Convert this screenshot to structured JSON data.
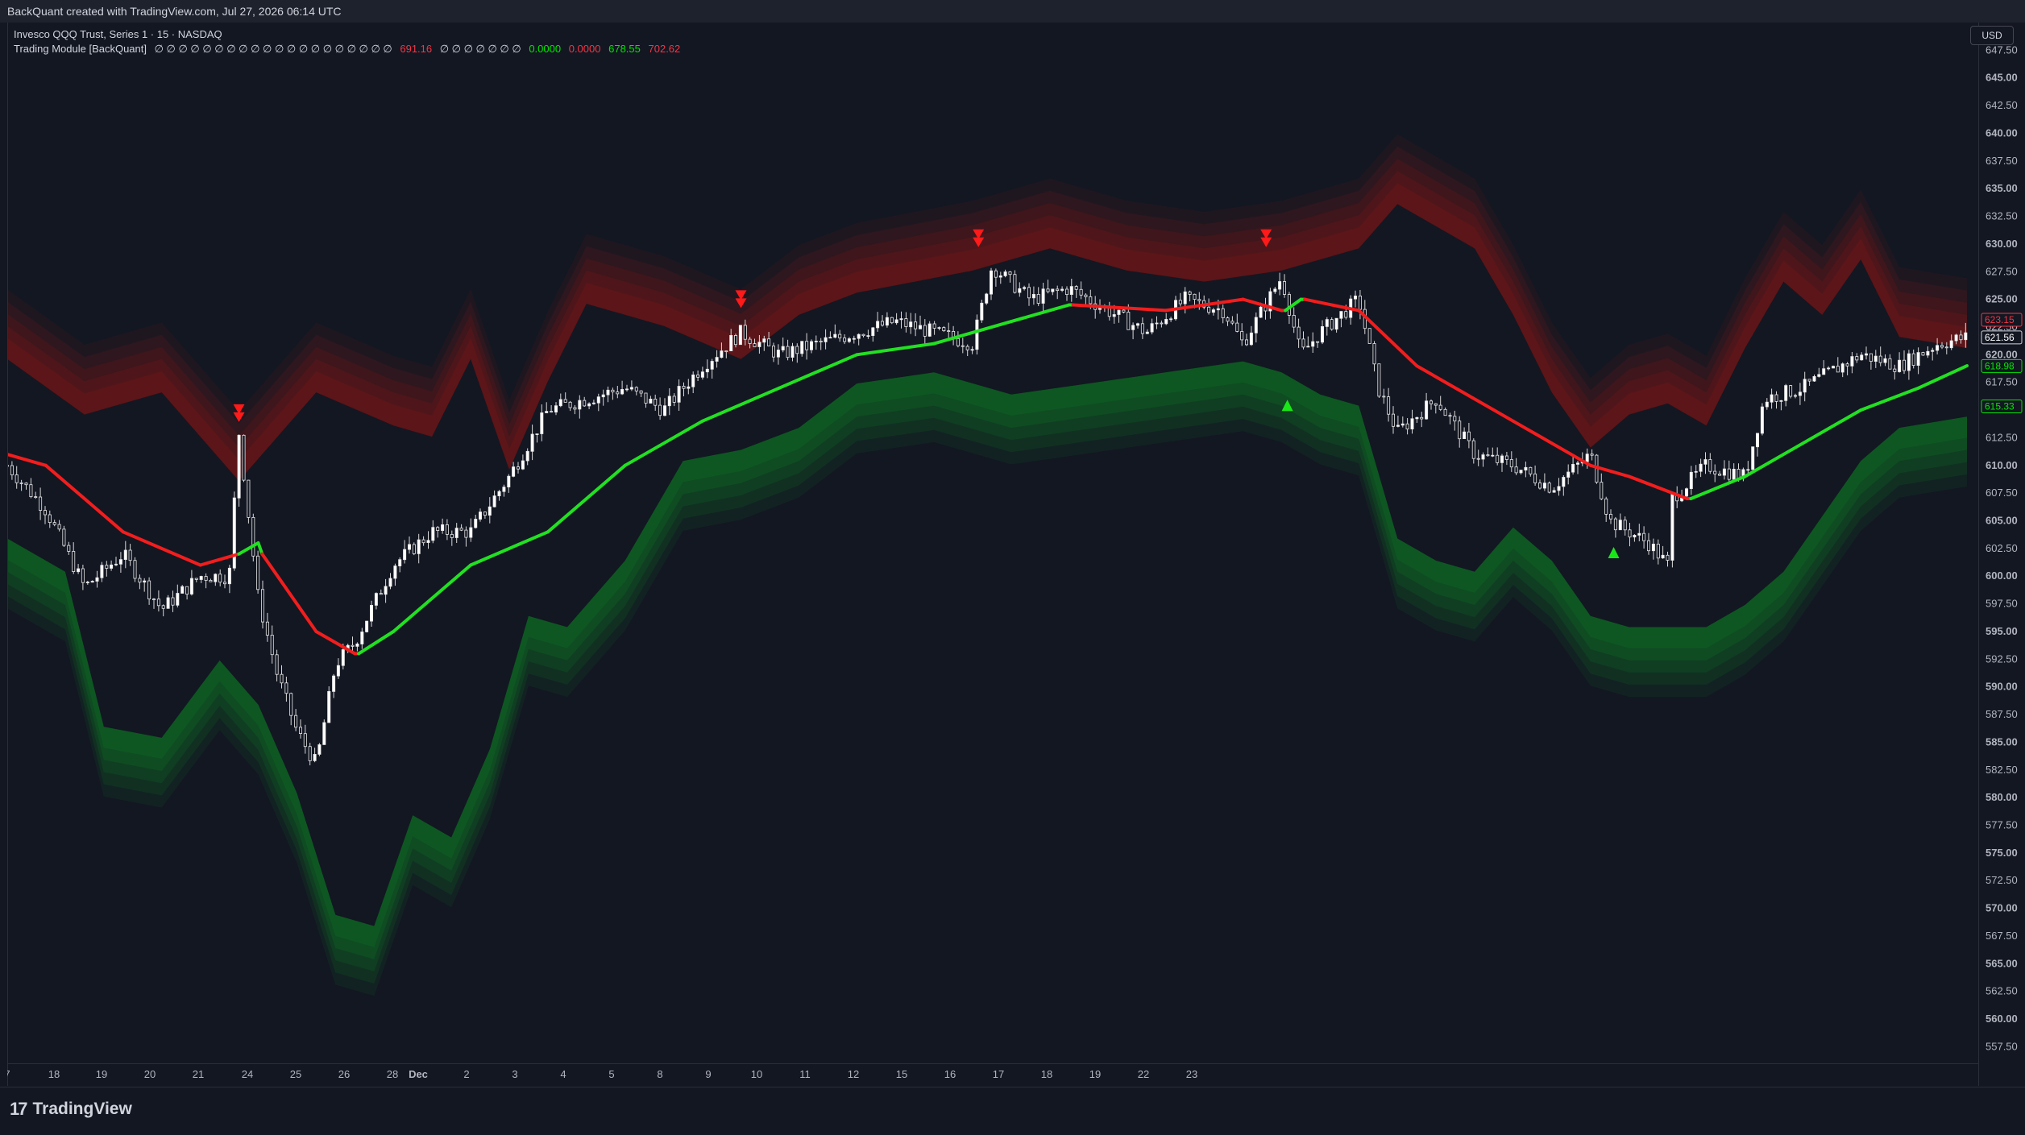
{
  "header": {
    "attribution": "BackQuant created with TradingView.com, Jul 27, 2026 06:14 UTC"
  },
  "legend": {
    "symbol_line": "Invesco QQQ Trust, Series 1 · 15 · NASDAQ",
    "indicator_name": "Trading Module [BackQuant]",
    "na_glyphs": "∅ ∅ ∅ ∅ ∅ ∅ ∅ ∅ ∅ ∅ ∅ ∅ ∅ ∅ ∅ ∅ ∅ ∅ ∅ ∅",
    "values": [
      {
        "text": "691.16",
        "color": "#f23645"
      },
      {
        "text": "∅ ∅ ∅ ∅ ∅ ∅ ∅",
        "color": "#d1d4dc"
      },
      {
        "text": "0.0000",
        "color": "#00e600"
      },
      {
        "text": "0.0000",
        "color": "#f23645"
      },
      {
        "text": "678.55",
        "color": "#00e600"
      },
      {
        "text": "702.62",
        "color": "#f23645"
      }
    ]
  },
  "currency_button": "USD",
  "footer": {
    "brand_logo": "17",
    "brand_name": "TradingView"
  },
  "colors": {
    "background": "#131722",
    "bull": "#22e022",
    "bear": "#f21d1d",
    "candle": "#ffffff",
    "band_upper": "#8b1a1a",
    "band_lower": "#0f6b24"
  },
  "chart_data": {
    "type": "candlestick",
    "title": "Invesco QQQ Trust, Series 1 · 15 · NASDAQ",
    "ylim": [
      556,
      650
    ],
    "y_ticks": [
      "647.50",
      "645.00",
      "642.50",
      "640.00",
      "637.50",
      "635.00",
      "632.50",
      "630.00",
      "627.50",
      "625.00",
      "622.50",
      "620.00",
      "617.50",
      "615.00",
      "612.50",
      "610.00",
      "607.50",
      "605.00",
      "602.50",
      "600.00",
      "597.50",
      "595.00",
      "592.50",
      "590.00",
      "587.50",
      "585.00",
      "582.50",
      "580.00",
      "577.50",
      "575.00",
      "572.50",
      "570.00",
      "567.50",
      "565.00",
      "562.50",
      "560.00",
      "557.50"
    ],
    "x_ticks": [
      "7",
      "18",
      "19",
      "20",
      "21",
      "24",
      "25",
      "26",
      "28",
      "Dec",
      "2",
      "3",
      "4",
      "5",
      "8",
      "9",
      "10",
      "11",
      "12",
      "15",
      "16",
      "17",
      "18",
      "19",
      "22",
      "23"
    ],
    "price_path": [
      {
        "t": 0,
        "p": 610
      },
      {
        "t": 2,
        "p": 606
      },
      {
        "t": 4,
        "p": 599
      },
      {
        "t": 6,
        "p": 602
      },
      {
        "t": 8,
        "p": 597
      },
      {
        "t": 10,
        "p": 600
      },
      {
        "t": 11.5,
        "p": 600
      },
      {
        "t": 12,
        "p": 613
      },
      {
        "t": 13,
        "p": 598
      },
      {
        "t": 14,
        "p": 591
      },
      {
        "t": 15,
        "p": 586
      },
      {
        "t": 16,
        "p": 583
      },
      {
        "t": 17,
        "p": 592
      },
      {
        "t": 18,
        "p": 594
      },
      {
        "t": 20,
        "p": 601
      },
      {
        "t": 22,
        "p": 604
      },
      {
        "t": 24,
        "p": 604
      },
      {
        "t": 26,
        "p": 609
      },
      {
        "t": 28,
        "p": 615
      },
      {
        "t": 30,
        "p": 616
      },
      {
        "t": 32,
        "p": 617
      },
      {
        "t": 34,
        "p": 615
      },
      {
        "t": 36,
        "p": 619
      },
      {
        "t": 38,
        "p": 622
      },
      {
        "t": 40,
        "p": 620
      },
      {
        "t": 42,
        "p": 621
      },
      {
        "t": 44,
        "p": 622
      },
      {
        "t": 46,
        "p": 623
      },
      {
        "t": 48,
        "p": 622
      },
      {
        "t": 50,
        "p": 621
      },
      {
        "t": 51,
        "p": 628
      },
      {
        "t": 53,
        "p": 625
      },
      {
        "t": 55,
        "p": 626
      },
      {
        "t": 57,
        "p": 624
      },
      {
        "t": 59,
        "p": 622
      },
      {
        "t": 61,
        "p": 625
      },
      {
        "t": 63,
        "p": 624
      },
      {
        "t": 64,
        "p": 621
      },
      {
        "t": 65,
        "p": 624
      },
      {
        "t": 66,
        "p": 627
      },
      {
        "t": 67,
        "p": 620
      },
      {
        "t": 68,
        "p": 622
      },
      {
        "t": 70,
        "p": 625
      },
      {
        "t": 71,
        "p": 617
      },
      {
        "t": 72,
        "p": 613
      },
      {
        "t": 74,
        "p": 616
      },
      {
        "t": 76,
        "p": 611
      },
      {
        "t": 78,
        "p": 610
      },
      {
        "t": 80,
        "p": 608
      },
      {
        "t": 82,
        "p": 611
      },
      {
        "t": 83,
        "p": 605
      },
      {
        "t": 85,
        "p": 603
      },
      {
        "t": 86,
        "p": 601
      },
      {
        "t": 86.2,
        "p": 607
      },
      {
        "t": 88,
        "p": 610
      },
      {
        "t": 90,
        "p": 609
      },
      {
        "t": 91,
        "p": 616
      },
      {
        "t": 93,
        "p": 617
      },
      {
        "t": 95,
        "p": 619
      },
      {
        "t": 96,
        "p": 620
      },
      {
        "t": 98,
        "p": 619
      },
      {
        "t": 100,
        "p": 621
      },
      {
        "t": 101.5,
        "p": 621.56
      }
    ],
    "trend_line": [
      {
        "t": 0,
        "p": 611,
        "s": "bear"
      },
      {
        "t": 2,
        "p": 610,
        "s": "bear"
      },
      {
        "t": 6,
        "p": 604,
        "s": "bear"
      },
      {
        "t": 10,
        "p": 601,
        "s": "bear"
      },
      {
        "t": 12,
        "p": 602,
        "s": "bull"
      },
      {
        "t": 13,
        "p": 603,
        "s": "bull"
      },
      {
        "t": 13.2,
        "p": 602,
        "s": "bear"
      },
      {
        "t": 16,
        "p": 595,
        "s": "bear"
      },
      {
        "t": 18,
        "p": 593,
        "s": "bear"
      },
      {
        "t": 18.2,
        "p": 593,
        "s": "bull"
      },
      {
        "t": 20,
        "p": 595,
        "s": "bull"
      },
      {
        "t": 24,
        "p": 601,
        "s": "bull"
      },
      {
        "t": 28,
        "p": 604,
        "s": "bull"
      },
      {
        "t": 32,
        "p": 610,
        "s": "bull"
      },
      {
        "t": 36,
        "p": 614,
        "s": "bull"
      },
      {
        "t": 40,
        "p": 617,
        "s": "bull"
      },
      {
        "t": 44,
        "p": 620,
        "s": "bull"
      },
      {
        "t": 48,
        "p": 621,
        "s": "bull"
      },
      {
        "t": 52,
        "p": 623,
        "s": "bull"
      },
      {
        "t": 55,
        "p": 624.5,
        "s": "bull"
      },
      {
        "t": 55.2,
        "p": 624.5,
        "s": "bear"
      },
      {
        "t": 60,
        "p": 624,
        "s": "bear"
      },
      {
        "t": 64,
        "p": 625,
        "s": "bear"
      },
      {
        "t": 66,
        "p": 624,
        "s": "bear"
      },
      {
        "t": 66.2,
        "p": 624,
        "s": "bull"
      },
      {
        "t": 67,
        "p": 625,
        "s": "bull"
      },
      {
        "t": 67.2,
        "p": 625,
        "s": "bear"
      },
      {
        "t": 70,
        "p": 624,
        "s": "bear"
      },
      {
        "t": 73,
        "p": 619,
        "s": "bear"
      },
      {
        "t": 78,
        "p": 614,
        "s": "bear"
      },
      {
        "t": 82,
        "p": 610,
        "s": "bear"
      },
      {
        "t": 84,
        "p": 609,
        "s": "bear"
      },
      {
        "t": 87,
        "p": 607,
        "s": "bear"
      },
      {
        "t": 87.2,
        "p": 607,
        "s": "bull"
      },
      {
        "t": 90,
        "p": 609,
        "s": "bull"
      },
      {
        "t": 93,
        "p": 612,
        "s": "bull"
      },
      {
        "t": 96,
        "p": 615,
        "s": "bull"
      },
      {
        "t": 99,
        "p": 617,
        "s": "bull"
      },
      {
        "t": 101.5,
        "p": 619,
        "s": "bull"
      }
    ],
    "upper_band": [
      {
        "t": 0,
        "p": 620
      },
      {
        "t": 4,
        "p": 615
      },
      {
        "t": 8,
        "p": 617
      },
      {
        "t": 12,
        "p": 609
      },
      {
        "t": 16,
        "p": 617
      },
      {
        "t": 20,
        "p": 614
      },
      {
        "t": 22,
        "p": 613
      },
      {
        "t": 24,
        "p": 620
      },
      {
        "t": 26,
        "p": 610
      },
      {
        "t": 28,
        "p": 618
      },
      {
        "t": 30,
        "p": 625
      },
      {
        "t": 34,
        "p": 623
      },
      {
        "t": 38,
        "p": 620
      },
      {
        "t": 41,
        "p": 624
      },
      {
        "t": 44,
        "p": 626
      },
      {
        "t": 50,
        "p": 628
      },
      {
        "t": 54,
        "p": 630
      },
      {
        "t": 58,
        "p": 628
      },
      {
        "t": 62,
        "p": 627
      },
      {
        "t": 66,
        "p": 628
      },
      {
        "t": 70,
        "p": 630
      },
      {
        "t": 72,
        "p": 634
      },
      {
        "t": 76,
        "p": 630
      },
      {
        "t": 78,
        "p": 624
      },
      {
        "t": 80,
        "p": 617
      },
      {
        "t": 82,
        "p": 612
      },
      {
        "t": 84,
        "p": 615
      },
      {
        "t": 86,
        "p": 616
      },
      {
        "t": 88,
        "p": 614
      },
      {
        "t": 90,
        "p": 621
      },
      {
        "t": 92,
        "p": 627
      },
      {
        "t": 94,
        "p": 624
      },
      {
        "t": 96,
        "p": 629
      },
      {
        "t": 98,
        "p": 622
      },
      {
        "t": 101.5,
        "p": 621
      }
    ],
    "lower_band": [
      {
        "t": 0,
        "p": 603
      },
      {
        "t": 3,
        "p": 600
      },
      {
        "t": 5,
        "p": 586
      },
      {
        "t": 8,
        "p": 585
      },
      {
        "t": 11,
        "p": 592
      },
      {
        "t": 13,
        "p": 588
      },
      {
        "t": 15,
        "p": 580
      },
      {
        "t": 17,
        "p": 569
      },
      {
        "t": 19,
        "p": 568
      },
      {
        "t": 21,
        "p": 578
      },
      {
        "t": 23,
        "p": 576
      },
      {
        "t": 25,
        "p": 584
      },
      {
        "t": 27,
        "p": 596
      },
      {
        "t": 29,
        "p": 595
      },
      {
        "t": 32,
        "p": 601
      },
      {
        "t": 35,
        "p": 610
      },
      {
        "t": 38,
        "p": 611
      },
      {
        "t": 41,
        "p": 613
      },
      {
        "t": 44,
        "p": 617
      },
      {
        "t": 48,
        "p": 618
      },
      {
        "t": 52,
        "p": 616
      },
      {
        "t": 56,
        "p": 617
      },
      {
        "t": 60,
        "p": 618
      },
      {
        "t": 64,
        "p": 619
      },
      {
        "t": 66,
        "p": 618
      },
      {
        "t": 68,
        "p": 616
      },
      {
        "t": 70,
        "p": 615
      },
      {
        "t": 72,
        "p": 603
      },
      {
        "t": 74,
        "p": 601
      },
      {
        "t": 76,
        "p": 600
      },
      {
        "t": 78,
        "p": 604
      },
      {
        "t": 80,
        "p": 601
      },
      {
        "t": 82,
        "p": 596
      },
      {
        "t": 84,
        "p": 595
      },
      {
        "t": 86,
        "p": 595
      },
      {
        "t": 88,
        "p": 595
      },
      {
        "t": 90,
        "p": 597
      },
      {
        "t": 92,
        "p": 600
      },
      {
        "t": 94,
        "p": 605
      },
      {
        "t": 96,
        "p": 610
      },
      {
        "t": 98,
        "p": 613
      },
      {
        "t": 101.5,
        "p": 614
      }
    ],
    "signals": [
      {
        "t": 12,
        "p": 614.5,
        "dir": "sell"
      },
      {
        "t": 38,
        "p": 624.8,
        "dir": "sell"
      },
      {
        "t": 50.3,
        "p": 630.3,
        "dir": "sell"
      },
      {
        "t": 65.2,
        "p": 630.3,
        "dir": "sell"
      },
      {
        "t": 66.3,
        "p": 615.5,
        "dir": "buy"
      },
      {
        "t": 83.2,
        "p": 602.2,
        "dir": "buy"
      }
    ],
    "price_tags": [
      {
        "text": "623.15",
        "p": 623.15,
        "border": "#f23645",
        "color": "#f23645"
      },
      {
        "text": "621.56",
        "p": 621.56,
        "border": "#d1d4dc",
        "color": "#ffffff"
      },
      {
        "text": "618.98",
        "p": 618.98,
        "border": "#00e600",
        "color": "#00e600"
      },
      {
        "text": "615.33",
        "p": 615.33,
        "border": "#00e600",
        "color": "#00e600"
      }
    ]
  }
}
